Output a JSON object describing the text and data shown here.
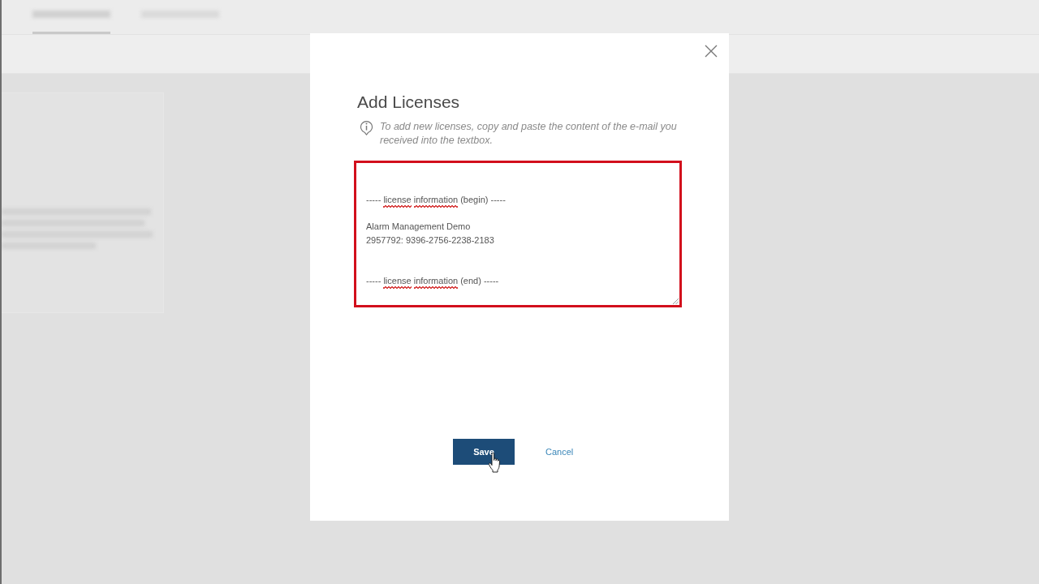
{
  "background": {
    "tabs": [
      {
        "selected": true
      },
      {
        "selected": false
      }
    ]
  },
  "dialog": {
    "title": "Add Licenses",
    "hint": "To add new licenses, copy and paste the content of the e-mail you received into the textbox.",
    "license_field": {
      "highlighted": true,
      "lines": [
        {
          "kind": "blank"
        },
        {
          "kind": "text",
          "segments": [
            {
              "text": "-----",
              "flagged": false
            },
            {
              "text": "license",
              "flagged": true
            },
            {
              "text": "information",
              "flagged": true
            },
            {
              "text": "(begin) -----",
              "flagged": false
            }
          ]
        },
        {
          "kind": "blank"
        },
        {
          "kind": "text",
          "segments": [
            {
              "text": "Alarm Management Demo",
              "flagged": false
            }
          ]
        },
        {
          "kind": "text",
          "segments": [
            {
              "text": "2957792: 9396-2756-2238-2183",
              "flagged": false
            }
          ]
        },
        {
          "kind": "blank"
        },
        {
          "kind": "blank"
        },
        {
          "kind": "text",
          "segments": [
            {
              "text": "-----",
              "flagged": false
            },
            {
              "text": "license",
              "flagged": true
            },
            {
              "text": "information",
              "flagged": true
            },
            {
              "text": "(end) -----",
              "flagged": false
            }
          ]
        }
      ]
    },
    "buttons": [
      {
        "kind": "primary",
        "label": "Save",
        "hovered": true
      },
      {
        "kind": "link",
        "label": "Cancel",
        "hovered": false
      }
    ]
  }
}
